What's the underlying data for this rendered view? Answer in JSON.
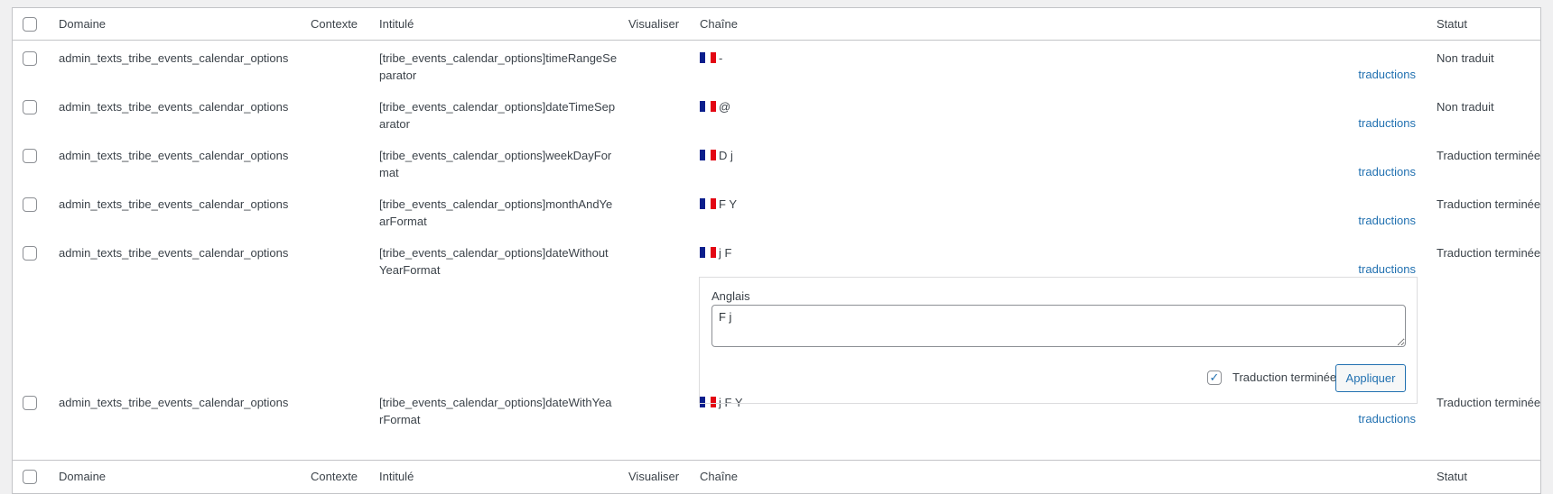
{
  "columns": {
    "domain": "Domaine",
    "context": "Contexte",
    "title": "Intitulé",
    "view": "Visualiser",
    "string": "Chaîne",
    "status": "Statut"
  },
  "rows": [
    {
      "domain": "admin_texts_tribe_events_calendar_options",
      "title1": "[tribe_events_calendar_options]timeRangeSe",
      "title2": "parator",
      "string": "-",
      "link": "traductions",
      "status": "Non traduit"
    },
    {
      "domain": "admin_texts_tribe_events_calendar_options",
      "title1": "[tribe_events_calendar_options]dateTimeSep",
      "title2": "arator",
      "string": "@",
      "link": "traductions",
      "status": "Non traduit"
    },
    {
      "domain": "admin_texts_tribe_events_calendar_options",
      "title1": "[tribe_events_calendar_options]weekDayFor",
      "title2": "mat",
      "string": "D j",
      "link": "traductions",
      "status": "Traduction terminée"
    },
    {
      "domain": "admin_texts_tribe_events_calendar_options",
      "title1": "[tribe_events_calendar_options]monthAndYe",
      "title2": "arFormat",
      "string": "F Y",
      "link": "traductions",
      "status": "Traduction terminée"
    },
    {
      "domain": "admin_texts_tribe_events_calendar_options",
      "title1": "[tribe_events_calendar_options]dateWithout",
      "title2": "YearFormat",
      "string": "j F",
      "link": "traductions",
      "status": "Traduction terminée"
    },
    {
      "domain": "admin_texts_tribe_events_calendar_options",
      "title1": "[tribe_events_calendar_options]dateWithYea",
      "title2": "rFormat",
      "string": "j F Y",
      "link": "traductions",
      "status": "Traduction terminée"
    }
  ],
  "editor": {
    "language": "Anglais",
    "value": "F j",
    "complete_label": "Traduction terminée",
    "complete_checked": true,
    "apply": "Appliquer"
  }
}
